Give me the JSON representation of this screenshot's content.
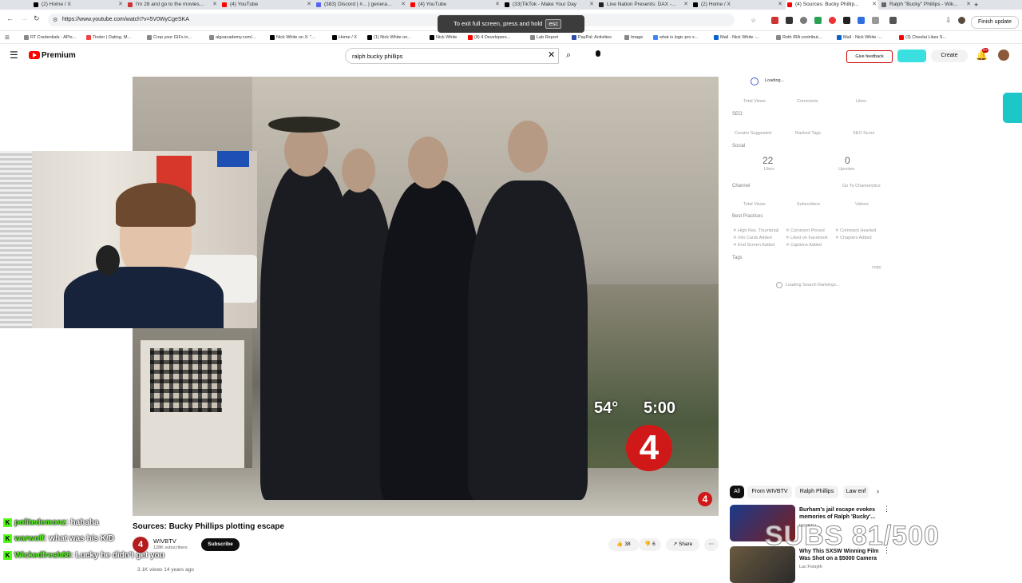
{
  "browser": {
    "tabs": [
      {
        "label": "(2) Home / X",
        "color": "#000"
      },
      {
        "label": "I'm 28 and go to the movies...",
        "color": "#c33"
      },
      {
        "label": "(4) YouTube",
        "color": "#f00"
      },
      {
        "label": "(383) Discord | #... | genera...",
        "color": "#5865f2"
      },
      {
        "label": "(4) YouTube",
        "color": "#f00"
      },
      {
        "label": "(33)TikTok - Make Your Day",
        "color": "#000"
      },
      {
        "label": "Live Nation Presents: DAX -...",
        "color": "#000"
      },
      {
        "label": "(2) Home / X",
        "color": "#000"
      },
      {
        "label": "(4) Sources: Bucky Phillip...",
        "color": "#f00"
      },
      {
        "label": "Ralph \"Bucky\" Phillips - Wik...",
        "color": "#666"
      }
    ],
    "url": "https://www.youtube.com/watch?v=5V0WyCgeSKA",
    "fullscreen_notice": "To exit full screen, press and hold",
    "esc_key": "esc",
    "finish_update": "Finish update",
    "bookmarks": [
      "RT Credentials - APIs...",
      "Tinder | Dating, M...",
      "Crop your GIFs in...",
      "algoacademy.com/...",
      "Nick White on X: \"...",
      "Home / X",
      "(1) Nick White on...",
      "Nick White",
      "(8) 4 Developers...",
      "Lab Report",
      "PayPal: Activities",
      "Image",
      "what is logic pro x...",
      "Mail - Nick White -...",
      "Roth IRA contribut...",
      "Mail - Nick White -...",
      "(3) Cheelai Likes S..."
    ]
  },
  "youtube": {
    "brand": "Premium",
    "search_query": "ralph bucky phillips",
    "give_feedback": "Give feedback",
    "create": "Create",
    "notifications": "9+"
  },
  "video": {
    "overlay_temp": "54°",
    "overlay_time": "5:00",
    "channel_logo": "4",
    "title": "Sources: Bucky Phillips plotting escape",
    "channel": "WIVBTV",
    "subscribers": "128K subscribers",
    "subscribe": "Subscribe",
    "likes": "38",
    "dislikes": "6",
    "share": "Share",
    "views": "3.1K views  14 years ago"
  },
  "chat": [
    {
      "user": "politedemonz",
      "msg": ": hahaha"
    },
    {
      "user": "warwolf",
      "msg": ": what was his K/D"
    },
    {
      "user": "Wickedfresh88",
      "msg": ": Lucky he didn't get you"
    }
  ],
  "extension": {
    "loading": "Loading...",
    "stats1": [
      "Total Views",
      "Comments",
      "Likes"
    ],
    "seo": "SEO",
    "seo_row": [
      "Creator Suggested",
      "Ranked Tags",
      "SEO Score"
    ],
    "social": "Social",
    "likes_num": "22",
    "likes_lbl": "Likes",
    "upvotes_num": "0",
    "upvotes_lbl": "Upvotes",
    "channel": "Channel",
    "go_channel": "Go To Channelytics",
    "stats2": [
      "Total Views",
      "Subscribers",
      "Videos"
    ],
    "best_practices": "Best Practices",
    "bp": [
      "High Res. Thumbnail",
      "Comment Pinned",
      "Comment Hearted",
      "Info Cards Added",
      "Liked on Facebook",
      "Chapters Added",
      "End Screen Added",
      "Captions Added"
    ],
    "tags": "Tags",
    "copy": "copy",
    "loading_rank": "Loading Search Rankings..."
  },
  "chips": [
    "All",
    "From WIVBTV",
    "Ralph Phillips",
    "Law enf"
  ],
  "recommendations": [
    {
      "title": "Burham's jail escape evokes memories of Ralph 'Bucky'...",
      "source": "WIVBTV"
    },
    {
      "title": "Why This SXSW Winning Film Was Shot on a $5000 Camera",
      "source": "Luc Forsyth"
    }
  ],
  "subs_overlay": "SUBS 81/500"
}
